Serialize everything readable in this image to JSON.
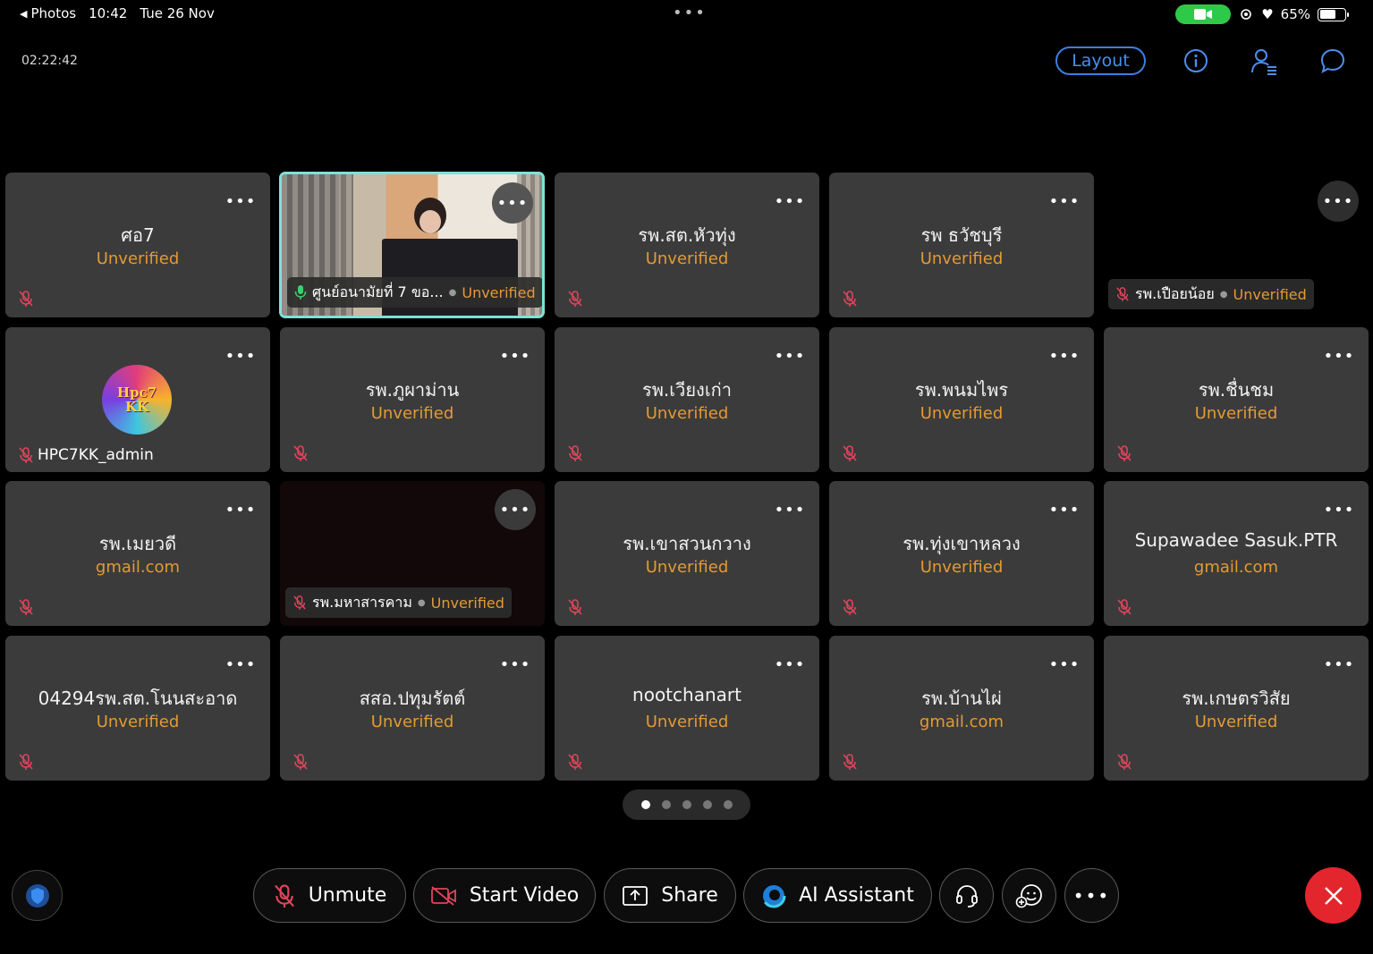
{
  "status_bar": {
    "back_app": "Photos",
    "time": "10:42",
    "date": "Tue 26 Nov",
    "battery": "65%",
    "battery_level": 0.65
  },
  "meeting": {
    "timer": "02:22:42",
    "layout_label": "Layout"
  },
  "tiles": [
    {
      "name": "ศอ7",
      "sub": "Unverified"
    },
    {
      "label_name": "ศูนย์อนามัยที่ 7 ขอ...",
      "label_sub": "Unverified"
    },
    {
      "name": "รพ.สต.หัวทุ่ง",
      "sub": "Unverified"
    },
    {
      "name": "รพ ธวัชบุรี",
      "sub": "Unverified"
    },
    {
      "label_name": "รพ.เปือยน้อย",
      "label_sub": "Unverified"
    },
    {
      "admin_name": "HPC7KK_admin",
      "avatar_line1": "Hpc7",
      "avatar_line2": "KK"
    },
    {
      "name": "รพ.ภูผาม่าน",
      "sub": "Unverified"
    },
    {
      "name": "รพ.เวียงเก่า",
      "sub": "Unverified"
    },
    {
      "name": "รพ.พนมไพร",
      "sub": "Unverified"
    },
    {
      "name": "รพ.ชื่นชม",
      "sub": "Unverified"
    },
    {
      "name": "รพ.เมยวดี",
      "sub": "gmail.com"
    },
    {
      "label_name": "รพ.มหาสารคาม",
      "label_sub": "Unverified"
    },
    {
      "name": "รพ.เขาสวนกวาง",
      "sub": "Unverified"
    },
    {
      "name": "รพ.ทุ่งเขาหลวง",
      "sub": "Unverified"
    },
    {
      "name": "Supawadee Sasuk.PTR",
      "sub": "gmail.com"
    },
    {
      "name": "04294รพ.สต.โนนสะอาด",
      "sub": "Unverified"
    },
    {
      "name": "สสอ.ปทุมรัตต์",
      "sub": "Unverified"
    },
    {
      "name": "nootchanart",
      "sub": "Unverified"
    },
    {
      "name": "รพ.บ้านไผ่",
      "sub": "gmail.com"
    },
    {
      "name": "รพ.เกษตรวิสัย",
      "sub": "Unverified"
    }
  ],
  "pager": {
    "pages": 5,
    "current": 1
  },
  "toolbar": {
    "unmute_label": "Unmute",
    "start_video_label": "Start Video",
    "share_label": "Share",
    "ai_assistant_label": "AI Assistant"
  },
  "colors": {
    "accent_blue": "#3d7fe0",
    "unverified_orange": "#e49a33",
    "leave_red": "#e3262d",
    "active_speaker_border": "#7fe0d6",
    "camera_pill_green": "#2fc94a"
  }
}
